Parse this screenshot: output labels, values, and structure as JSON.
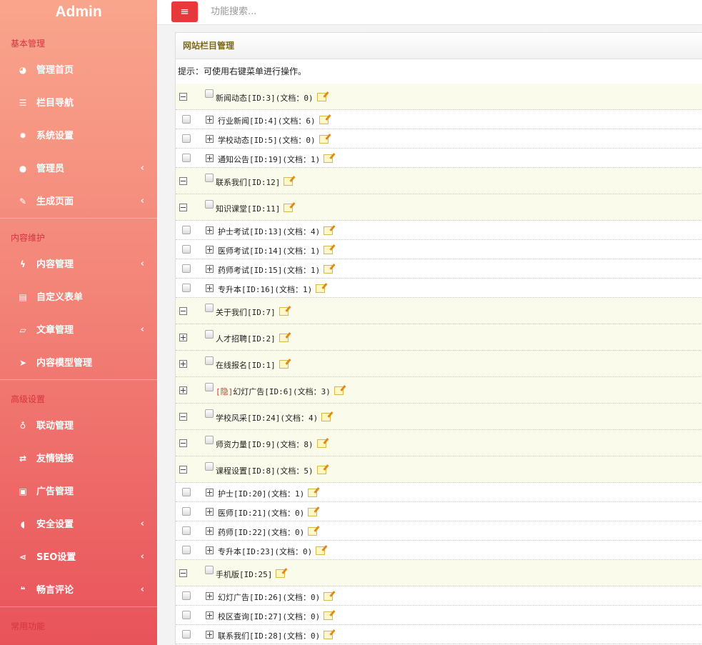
{
  "brand": "Admin",
  "sidebar": {
    "groups": [
      {
        "label": "基本管理",
        "items": [
          {
            "label": "管理首页",
            "icon": "dashboard-icon",
            "glyph": "◕",
            "chevron": false
          },
          {
            "label": "栏目导航",
            "icon": "list-icon",
            "glyph": "☰",
            "chevron": false
          },
          {
            "label": "系统设置",
            "icon": "gear-icon",
            "glyph": "✹",
            "chevron": false
          },
          {
            "label": "管理员",
            "icon": "user-icon",
            "glyph": "●",
            "chevron": true
          },
          {
            "label": "生成页面",
            "icon": "brush-icon",
            "glyph": "✎",
            "chevron": true
          }
        ]
      },
      {
        "label": "内容维护",
        "items": [
          {
            "label": "内容管理",
            "icon": "bolt-icon",
            "glyph": "ϟ",
            "chevron": true
          },
          {
            "label": "自定义表单",
            "icon": "file-icon",
            "glyph": "▤",
            "chevron": false
          },
          {
            "label": "文章管理",
            "icon": "folder-open-icon",
            "glyph": "▱",
            "chevron": true
          },
          {
            "label": "内容模型管理",
            "icon": "paper-plane-icon",
            "glyph": "➤",
            "chevron": false
          }
        ]
      },
      {
        "label": "高级设置",
        "items": [
          {
            "label": "联动管理",
            "icon": "lightbulb-icon",
            "glyph": "♁",
            "chevron": false
          },
          {
            "label": "友情链接",
            "icon": "exchange-icon",
            "glyph": "⇄",
            "chevron": false
          },
          {
            "label": "广告管理",
            "icon": "cube-icon",
            "glyph": "▣",
            "chevron": false
          },
          {
            "label": "安全设置",
            "icon": "shield-icon",
            "glyph": "◖",
            "chevron": true
          },
          {
            "label": "SEO设置",
            "icon": "share-icon",
            "glyph": "⋖",
            "chevron": true
          },
          {
            "label": "畅言评论",
            "icon": "comments-icon",
            "glyph": "❝",
            "chevron": true
          }
        ]
      },
      {
        "label": "常用功能",
        "items": []
      }
    ],
    "chevron_glyph": "‹"
  },
  "topbar": {
    "menu_glyph": "≡",
    "search_placeholder": "功能搜索..."
  },
  "panel": {
    "title": "网站栏目管理",
    "tip": "提示：可使用右键菜单进行操作。"
  },
  "tree": [
    {
      "type": "parent",
      "expanded": true,
      "text": "新闻动态[ID:3](文档：0)"
    },
    {
      "type": "child",
      "text": "行业新闻[ID:4](文档：6)"
    },
    {
      "type": "child",
      "text": "学校动态[ID:5](文档：0)"
    },
    {
      "type": "child",
      "text": "通知公告[ID:19](文档：1)"
    },
    {
      "type": "parent",
      "expanded": true,
      "text": "联系我们[ID:12]"
    },
    {
      "type": "parent",
      "expanded": true,
      "text": "知识课堂[ID:11]"
    },
    {
      "type": "child",
      "text": "护士考试[ID:13](文档：4)"
    },
    {
      "type": "child",
      "text": "医师考试[ID:14](文档：1)"
    },
    {
      "type": "child",
      "text": "药师考试[ID:15](文档：1)"
    },
    {
      "type": "child",
      "text": "专升本[ID:16](文档：1)"
    },
    {
      "type": "parent",
      "expanded": true,
      "text": "关于我们[ID:7]"
    },
    {
      "type": "parent",
      "expanded": false,
      "text": "人才招聘[ID:2]"
    },
    {
      "type": "parent",
      "expanded": false,
      "text": "在线报名[ID:1]"
    },
    {
      "type": "parent",
      "expanded": false,
      "hidden_tag": "[隐]",
      "text": "幻灯广告[ID:6](文档：3)"
    },
    {
      "type": "parent",
      "expanded": true,
      "text": "学校风采[ID:24](文档：4)"
    },
    {
      "type": "parent",
      "expanded": true,
      "text": "师资力量[ID:9](文档：8)"
    },
    {
      "type": "parent",
      "expanded": true,
      "text": "课程设置[ID:8](文档：5)"
    },
    {
      "type": "child",
      "text": "护士[ID:20](文档：1)"
    },
    {
      "type": "child",
      "text": "医师[ID:21](文档：0)"
    },
    {
      "type": "child",
      "text": "药师[ID:22](文档：0)"
    },
    {
      "type": "child",
      "text": "专升本[ID:23](文档：0)"
    },
    {
      "type": "parent",
      "expanded": true,
      "text": "手机版[ID:25]"
    },
    {
      "type": "child",
      "text": "幻灯广告[ID:26](文档：0)"
    },
    {
      "type": "child",
      "text": "校区查询[ID:27](文档：0)"
    },
    {
      "type": "child",
      "text": "联系我们[ID:28](文档：0)"
    }
  ]
}
